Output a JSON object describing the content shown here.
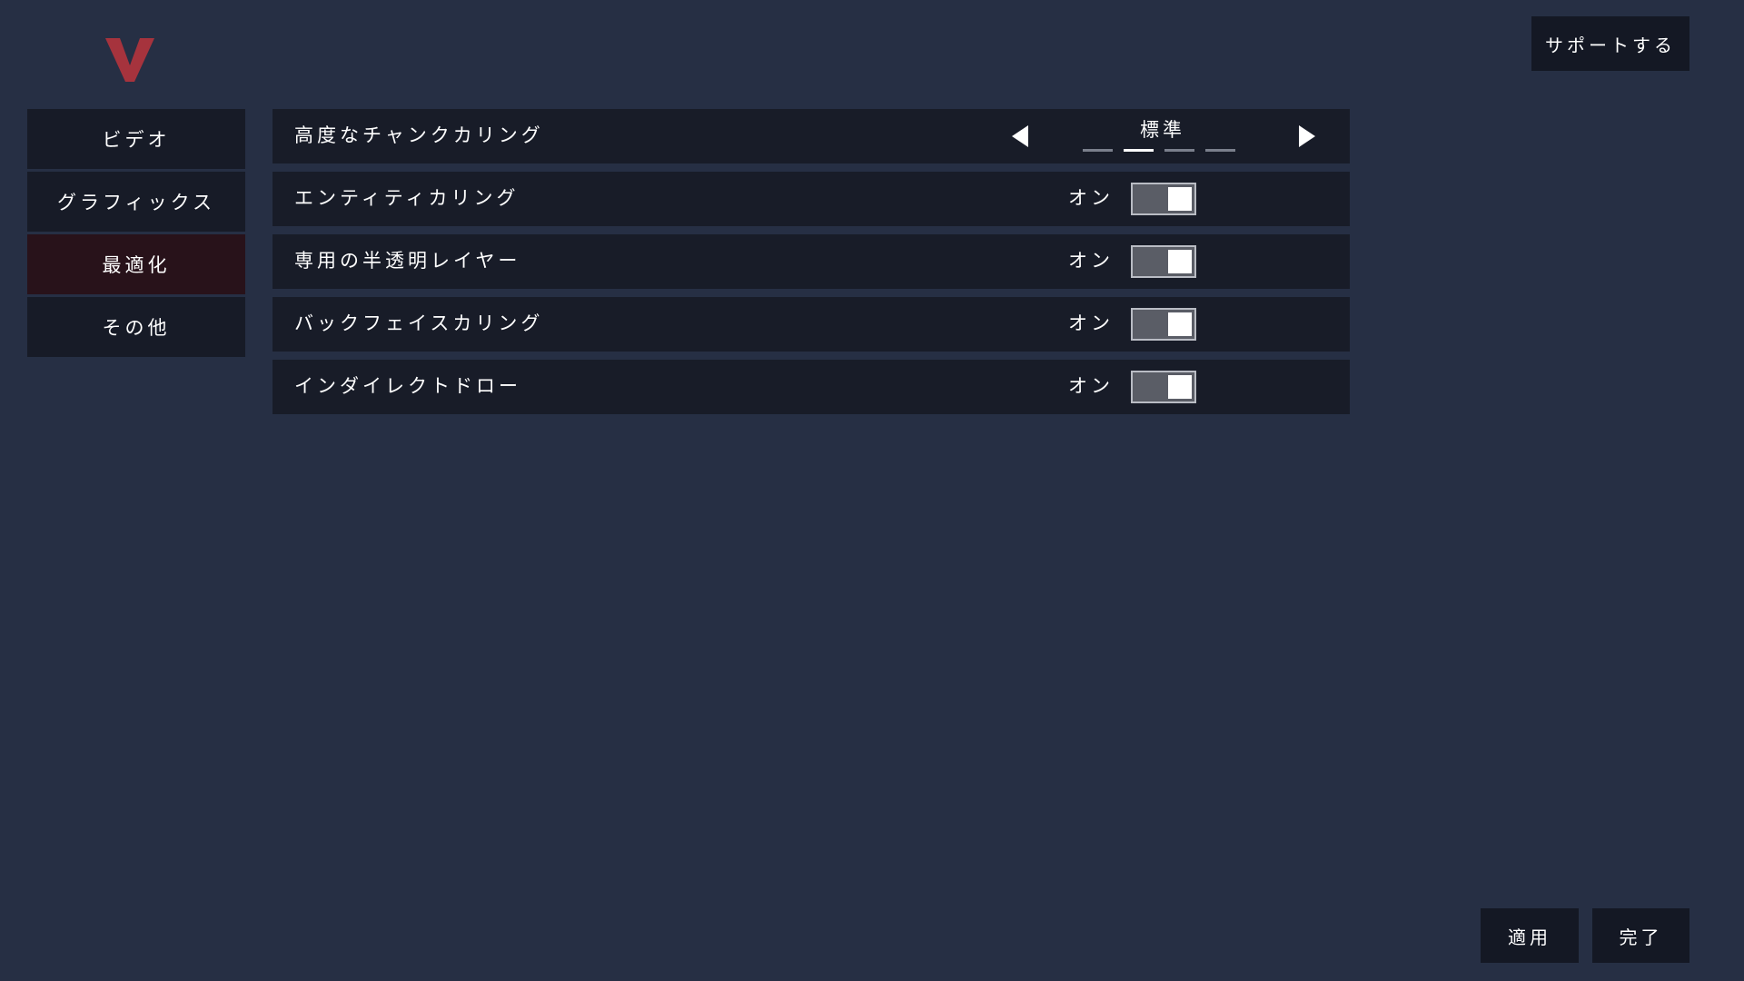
{
  "header": {
    "support_label": "サポートする"
  },
  "colors": {
    "logo": "#a6333d",
    "active_tab": "#28121a",
    "background": "#262f44"
  },
  "sidebar": {
    "items": [
      {
        "label": "ビデオ",
        "active": false
      },
      {
        "label": "グラフィックス",
        "active": false
      },
      {
        "label": "最適化",
        "active": true
      },
      {
        "label": "その他",
        "active": false
      }
    ]
  },
  "settings": {
    "chunk_culling": {
      "label": "高度なチャンクカリング",
      "value": "標準",
      "option_count": 4,
      "selected_index": 1
    },
    "entity_culling": {
      "label": "エンティティカリング",
      "state_label": "オン",
      "on": true
    },
    "translucent_layer": {
      "label": "専用の半透明レイヤー",
      "state_label": "オン",
      "on": true
    },
    "backface_culling": {
      "label": "バックフェイスカリング",
      "state_label": "オン",
      "on": true
    },
    "indirect_draw": {
      "label": "インダイレクトドロー",
      "state_label": "オン",
      "on": true
    }
  },
  "footer": {
    "apply_label": "適用",
    "done_label": "完了"
  }
}
